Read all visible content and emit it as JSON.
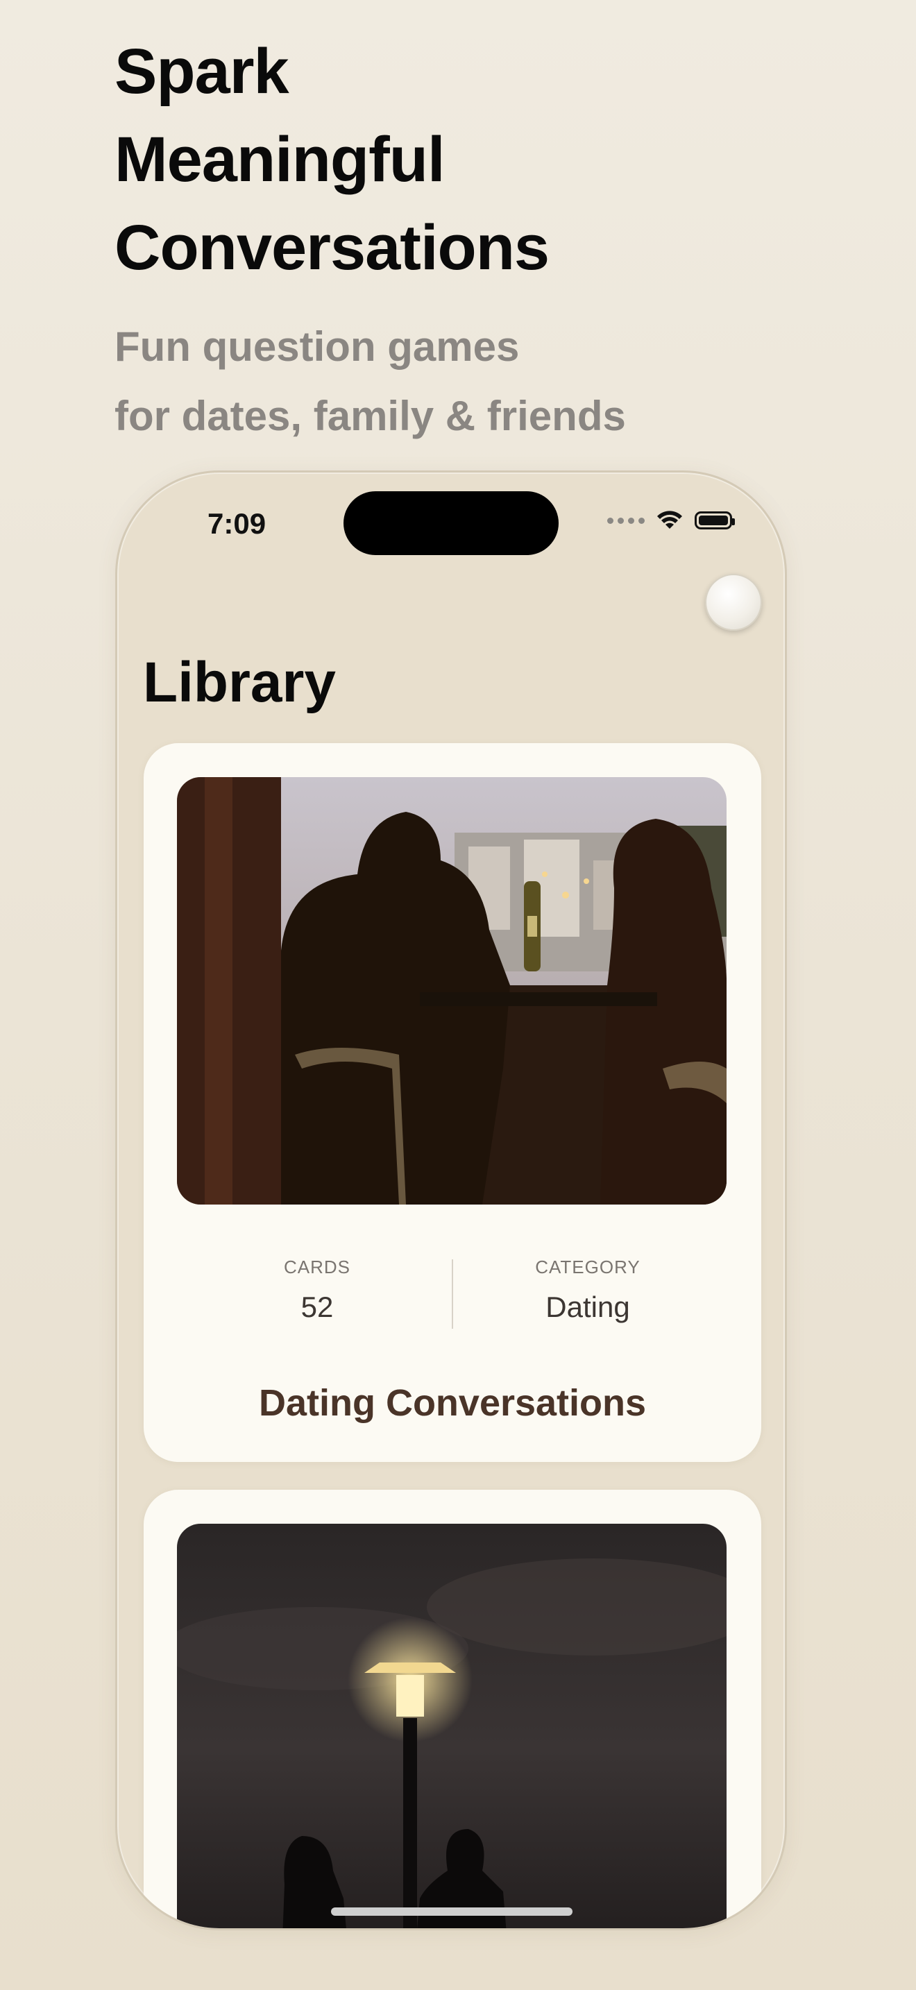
{
  "headline": [
    "Spark",
    "Meaningful",
    "Conversations"
  ],
  "subheadline": [
    "Fun question games",
    "for dates, family & friends"
  ],
  "status_bar": {
    "time": "7:09"
  },
  "library": {
    "title": "Library",
    "cards": [
      {
        "title": "Dating Conversations",
        "cards_label": "CARDS",
        "cards_count": "52",
        "category_label": "CATEGORY",
        "category": "Dating",
        "image_icon": "couple-dinner-photo"
      },
      {
        "image_icon": "streetlamp-night-photo"
      }
    ]
  },
  "icons": [
    "wifi-icon",
    "battery-icon",
    "signal-dots-icon",
    "profile-avatar-icon"
  ],
  "colors": {
    "background": "#ebe4d6",
    "card": "#fcfaf3",
    "title_brown": "#4a3428"
  }
}
